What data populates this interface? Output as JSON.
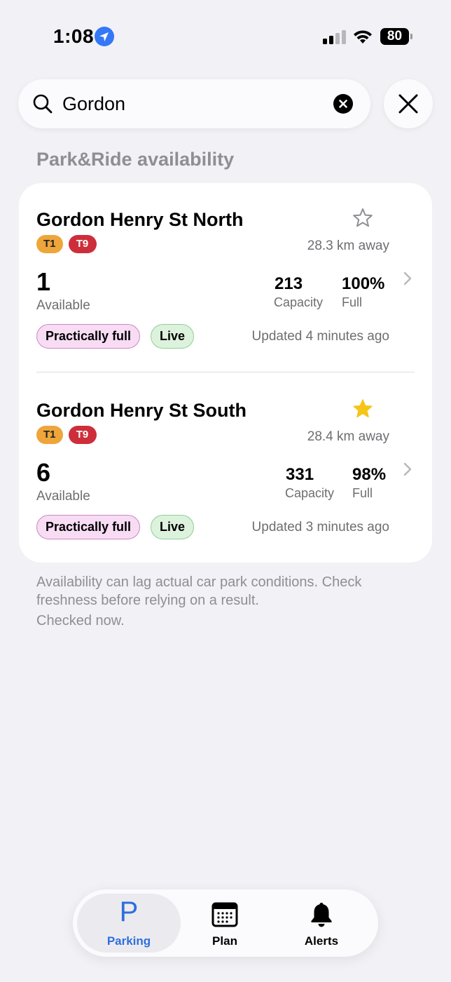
{
  "status_bar": {
    "time": "1:08",
    "battery": "80"
  },
  "search": {
    "value": "Gordon",
    "placeholder": "Search"
  },
  "section_title": "Park&Ride availability",
  "car_parks": [
    {
      "name": "Gordon Henry St North",
      "favorited": false,
      "lines": [
        "T1",
        "T9"
      ],
      "distance": "28.3 km away",
      "available": "1",
      "available_label": "Available",
      "capacity": "213",
      "capacity_label": "Capacity",
      "full": "100%",
      "full_label": "Full",
      "status_tag": "Practically full",
      "live_tag": "Live",
      "updated": "Updated 4 minutes ago"
    },
    {
      "name": "Gordon Henry St South",
      "favorited": true,
      "lines": [
        "T1",
        "T9"
      ],
      "distance": "28.4 km away",
      "available": "6",
      "available_label": "Available",
      "capacity": "331",
      "capacity_label": "Capacity",
      "full": "98%",
      "full_label": "Full",
      "status_tag": "Practically full",
      "live_tag": "Live",
      "updated": "Updated 3 minutes ago"
    }
  ],
  "disclaimer": "Availability can lag actual car park conditions. Check freshness before relying on a result.",
  "checked": "Checked now.",
  "tabs": [
    {
      "label": "Parking",
      "icon": "parking-icon",
      "active": true
    },
    {
      "label": "Plan",
      "icon": "calendar-icon",
      "active": false
    },
    {
      "label": "Alerts",
      "icon": "bell-icon",
      "active": false
    }
  ],
  "colors": {
    "accent": "#2f6fdb",
    "line_t1": "#eea53a",
    "line_t9": "#cd2e3a",
    "star_filled": "#f5c518",
    "tag_full_bg": "#f7dcf4",
    "tag_live_bg": "#dcf2dd"
  }
}
